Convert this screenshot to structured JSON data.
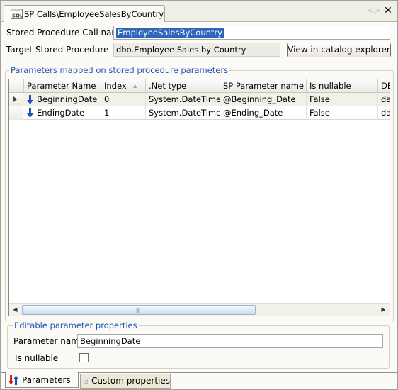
{
  "document_tab": {
    "title": "SP Calls\\EmployeeSalesByCountry",
    "icon": "sql-file-icon"
  },
  "window_controls": {
    "nav_left": "◁",
    "nav_right": "▷",
    "close": "✕"
  },
  "form": {
    "call_name_label": "Stored Procedure Call name",
    "call_name_value": "EmployeeSalesByCountry",
    "target_label": "Target Stored Procedure",
    "target_value": "dbo.Employee Sales by Country",
    "catalog_button": "View in catalog explorer"
  },
  "parameters_group": {
    "title": "Parameters mapped on stored procedure parameters",
    "columns": [
      "Parameter Name",
      "Index",
      ".Net type",
      "SP Parameter name",
      "Is nullable",
      "DB"
    ],
    "sort_indicator": "▲",
    "rows": [
      {
        "name": "BeginningDate",
        "index": "0",
        "net_type": "System.DateTime",
        "sp_name": "@Beginning_Date",
        "nullable": "False",
        "db": "dat"
      },
      {
        "name": "EndingDate",
        "index": "1",
        "net_type": "System.DateTime",
        "sp_name": "@Ending_Date",
        "nullable": "False",
        "db": "dat"
      }
    ]
  },
  "editable_group": {
    "title": "Editable parameter properties",
    "param_name_label": "Parameter name",
    "param_name_value": "BeginningDate",
    "nullable_label": "Is nullable",
    "nullable_checked": false
  },
  "bottom_tabs": {
    "parameters": "Parameters",
    "custom_properties": "Custom properties"
  },
  "colors": {
    "group_title": "#1f57b5",
    "selection": "#2d65b8",
    "direction_arrow": "#1f4fb0"
  }
}
